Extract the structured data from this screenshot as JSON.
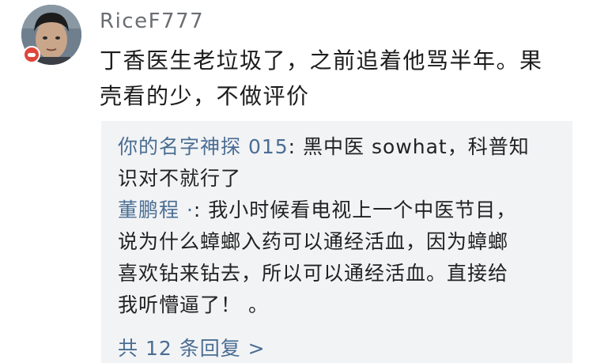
{
  "comment": {
    "username": "RiceF777",
    "avatar_icon": "user-avatar",
    "badge_icon": "badge-icon",
    "text_lines": [
      "丁香医生老垃圾了，之前追着他骂半年。果",
      "壳看的少，不做评价"
    ]
  },
  "replies": [
    {
      "name": "你的名字神探 015",
      "separator": ": ",
      "lines": [
        "黑中医 sowhat，科普知",
        "识对不就行了"
      ]
    },
    {
      "name": "董鹏程 ·",
      "separator": ": ",
      "lines": [
        "我小时候看电视上一个中医节目，",
        "说为什么蟑螂入药可以通经活血，因为蟑螂",
        "喜欢钻来钻去，所以可以通经活血。直接给",
        "我听懵逼了！ 。"
      ]
    }
  ],
  "more_replies_label": "共 12 条回复 >",
  "colors": {
    "username": "#6a6e72",
    "reply_name": "#4a6e93",
    "reply_box_bg": "#f2f3f5",
    "badge": "#e0453b"
  }
}
